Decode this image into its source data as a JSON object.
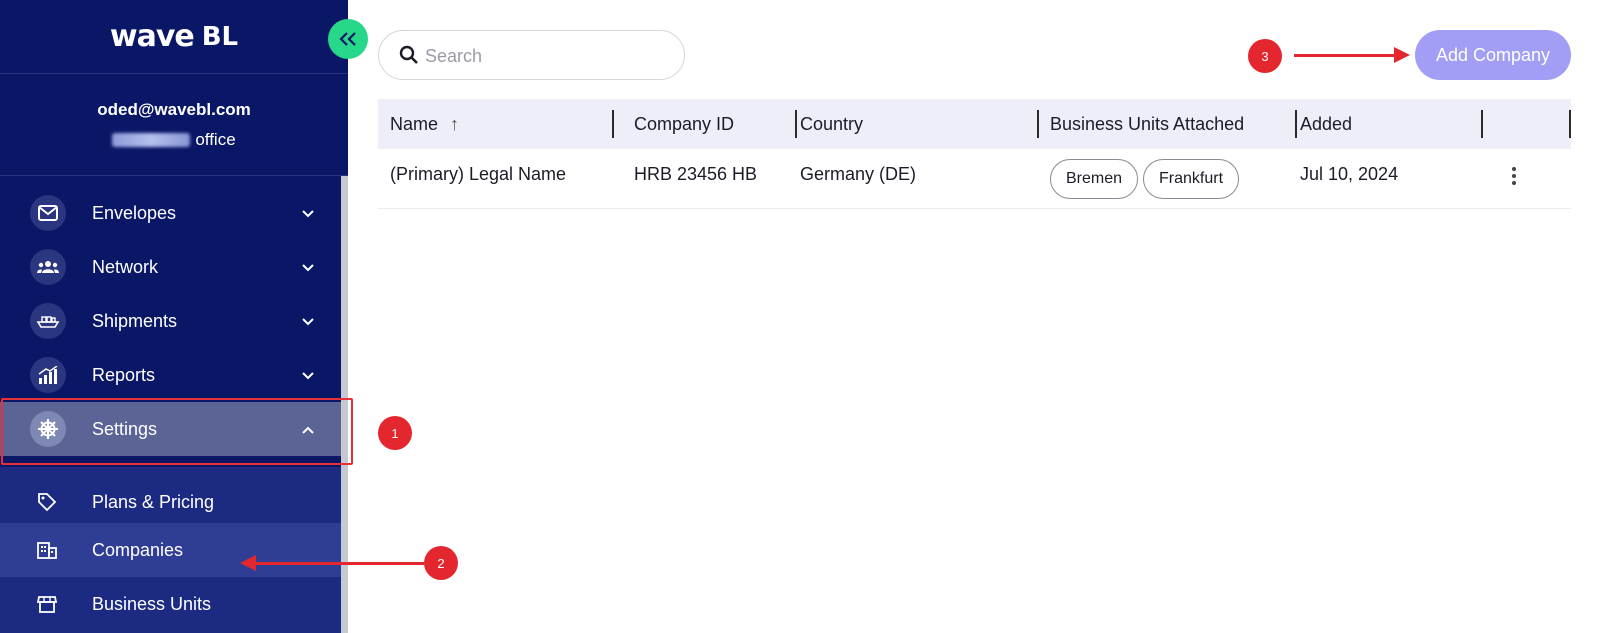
{
  "app": {
    "logo_main": "wave",
    "logo_suffix": "BL"
  },
  "user": {
    "email": "oded@wavebl.com",
    "office_suffix": "office"
  },
  "nav": {
    "items": [
      {
        "label": "Envelopes",
        "icon": "envelope-icon"
      },
      {
        "label": "Network",
        "icon": "people-icon"
      },
      {
        "label": "Shipments",
        "icon": "ship-icon"
      },
      {
        "label": "Reports",
        "icon": "chart-icon"
      },
      {
        "label": "Settings",
        "icon": "helm-icon",
        "expanded": true
      }
    ],
    "sub_items": [
      {
        "label": "Plans & Pricing",
        "icon": "tag-icon"
      },
      {
        "label": "Companies",
        "icon": "building-icon",
        "selected": true
      },
      {
        "label": "Business Units",
        "icon": "store-icon"
      }
    ]
  },
  "search": {
    "placeholder": "Search",
    "value": ""
  },
  "toolbar": {
    "add_label": "Add Company"
  },
  "table": {
    "columns": [
      "Name",
      "Company ID",
      "Country",
      "Business Units Attached",
      "Added"
    ],
    "sort_indicator": "↑",
    "rows": [
      {
        "name": "(Primary) Legal Name",
        "company_id": "HRB 23456 HB",
        "country": "Germany (DE)",
        "business_units": [
          "Bremen",
          "Frankfurt"
        ],
        "added": "Jul 10, 2024"
      }
    ]
  },
  "annotations": {
    "badge_1": "1",
    "badge_2": "2",
    "badge_3": "3"
  },
  "colors": {
    "sidebar": "#0a1766",
    "accent_green": "#27d88a",
    "add_button": "#a29ef5",
    "annotation_red": "#e4262e"
  }
}
